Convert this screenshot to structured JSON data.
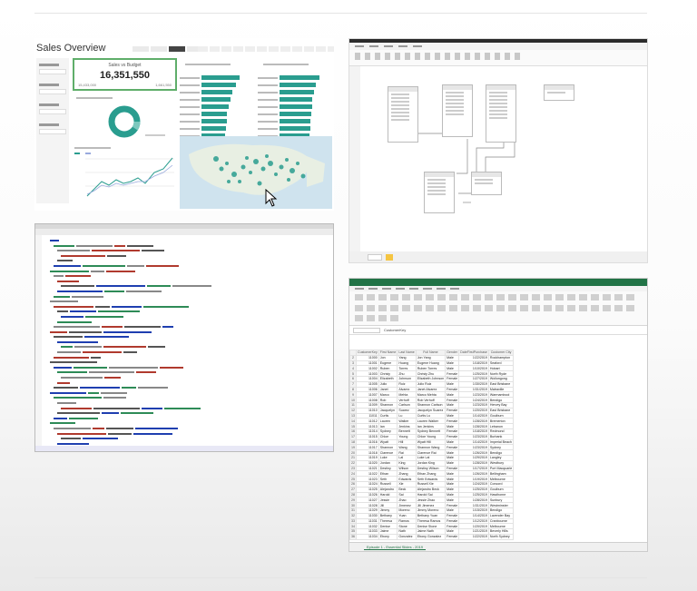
{
  "dashboard": {
    "title": "Sales Overview",
    "kpi_label": "Sales vs Budget",
    "kpi_value": "16,351,550",
    "kpi_sub_left": "15,433,000",
    "kpi_sub_right": "1,661,550",
    "accent": "#2a9d8f",
    "kpi_border": "#5fae6a"
  },
  "model": {},
  "code": {},
  "sheet": {
    "formula_value": "CustomerKey",
    "headers": [
      "CustomerKey",
      "First Name",
      "Last Name",
      "Full Name",
      "Gender",
      "DateFirstPurchase",
      "Customer City"
    ],
    "rows": [
      [
        "11000",
        "Jon",
        "Yang",
        "Jon Yang",
        "Male",
        "1/22/2019",
        "Rockhampton"
      ],
      [
        "11001",
        "Eugene",
        "Huang",
        "Eugene Huang",
        "Male",
        "1/18/2019",
        "Seaford"
      ],
      [
        "11002",
        "Ruben",
        "Torres",
        "Ruben Torres",
        "Male",
        "1/10/2019",
        "Hobart"
      ],
      [
        "11003",
        "Christy",
        "Zhu",
        "Christy Zhu",
        "Female",
        "1/25/2019",
        "North Ryde"
      ],
      [
        "11004",
        "Elizabeth",
        "Johnson",
        "Elizabeth Johnson",
        "Female",
        "1/27/2019",
        "Wollongong"
      ],
      [
        "11005",
        "Julio",
        "Ruiz",
        "Julio Ruiz",
        "Male",
        "1/30/2019",
        "East Brisbane"
      ],
      [
        "11006",
        "Janet",
        "Alvarez",
        "Janet Alvarez",
        "Female",
        "1/31/2019",
        "Matraville"
      ],
      [
        "11007",
        "Marco",
        "Mehta",
        "Marco Mehta",
        "Male",
        "1/23/2019",
        "Warrnambool"
      ],
      [
        "11008",
        "Rob",
        "Verhoff",
        "Rob Verhoff",
        "Female",
        "1/24/2019",
        "Bendigo"
      ],
      [
        "11009",
        "Shannon",
        "Carlson",
        "Shannon Carlson",
        "Male",
        "1/23/2019",
        "Hervey Bay"
      ],
      [
        "11010",
        "Jacquelyn",
        "Suarez",
        "Jacquelyn Suarez",
        "Female",
        "1/20/2019",
        "East Brisbane"
      ],
      [
        "11011",
        "Curtis",
        "Lu",
        "Curtis Lu",
        "Male",
        "1/14/2019",
        "Goulburn"
      ],
      [
        "11012",
        "Lauren",
        "Walker",
        "Lauren Walker",
        "Female",
        "1/28/2019",
        "Bremerton"
      ],
      [
        "11013",
        "Ian",
        "Jenkins",
        "Ian Jenkins",
        "Male",
        "1/28/2019",
        "Lebanon"
      ],
      [
        "11014",
        "Sydney",
        "Bennett",
        "Sydney Bennett",
        "Female",
        "1/18/2019",
        "Redmond"
      ],
      [
        "11015",
        "Chloe",
        "Young",
        "Chloe Young",
        "Female",
        "1/23/2019",
        "Burbank"
      ],
      [
        "11016",
        "Wyatt",
        "Hill",
        "Wyatt Hill",
        "Male",
        "1/14/2019",
        "Imperial Beach"
      ],
      [
        "11017",
        "Shannon",
        "Wang",
        "Shannon Wang",
        "Female",
        "1/23/2019",
        "Sydney"
      ],
      [
        "11018",
        "Clarence",
        "Rai",
        "Clarence Rai",
        "Male",
        "1/26/2019",
        "Bendigo"
      ],
      [
        "11019",
        "Luke",
        "Lal",
        "Luke Lal",
        "Male",
        "1/29/2019",
        "Langley"
      ],
      [
        "11020",
        "Jordan",
        "King",
        "Jordan King",
        "Male",
        "1/28/2019",
        "Westbury"
      ],
      [
        "11021",
        "Destiny",
        "Wilson",
        "Destiny Wilson",
        "Female",
        "1/17/2019",
        "Port Macquarie"
      ],
      [
        "11022",
        "Ethan",
        "Zhang",
        "Ethan Zhang",
        "Male",
        "1/26/2019",
        "Bellingham"
      ],
      [
        "11023",
        "Seth",
        "Edwards",
        "Seth Edwards",
        "Male",
        "1/19/2019",
        "Melbourne"
      ],
      [
        "11024",
        "Russell",
        "Xie",
        "Russell Xie",
        "Male",
        "1/24/2019",
        "Concord"
      ],
      [
        "11025",
        "Alejandro",
        "Beck",
        "Alejandro Beck",
        "Male",
        "1/25/2019",
        "Goulburn"
      ],
      [
        "11026",
        "Harold",
        "Sai",
        "Harold Sai",
        "Male",
        "1/25/2019",
        "Hawthorne"
      ],
      [
        "11027",
        "Jessie",
        "Zhao",
        "Jessie Zhao",
        "Male",
        "1/28/2019",
        "Sunbury"
      ],
      [
        "11028",
        "Jill",
        "Jimenez",
        "Jill Jimenez",
        "Female",
        "1/31/2019",
        "Westminster"
      ],
      [
        "11029",
        "Jimmy",
        "Moreno",
        "Jimmy Moreno",
        "Male",
        "1/15/2019",
        "Bendigo"
      ],
      [
        "11030",
        "Bethany",
        "Yuan",
        "Bethany Yuan",
        "Female",
        "1/14/2019",
        "Lavender Bay"
      ],
      [
        "11031",
        "Theresa",
        "Ramos",
        "Theresa Ramos",
        "Female",
        "1/12/2019",
        "Cranbourne"
      ],
      [
        "11032",
        "Denise",
        "Stone",
        "Denise Stone",
        "Female",
        "1/20/2019",
        "Melbourne"
      ],
      [
        "11033",
        "Jaime",
        "Nath",
        "Jaime Nath",
        "Male",
        "1/21/2019",
        "Beverly Hills"
      ],
      [
        "11034",
        "Ebony",
        "Gonzalez",
        "Ebony Gonzalez",
        "Female",
        "1/22/2019",
        "North Sydney"
      ]
    ],
    "tabs": [
      "Episode 1 - Essential Slides - 2019"
    ],
    "accent": "#217346"
  }
}
